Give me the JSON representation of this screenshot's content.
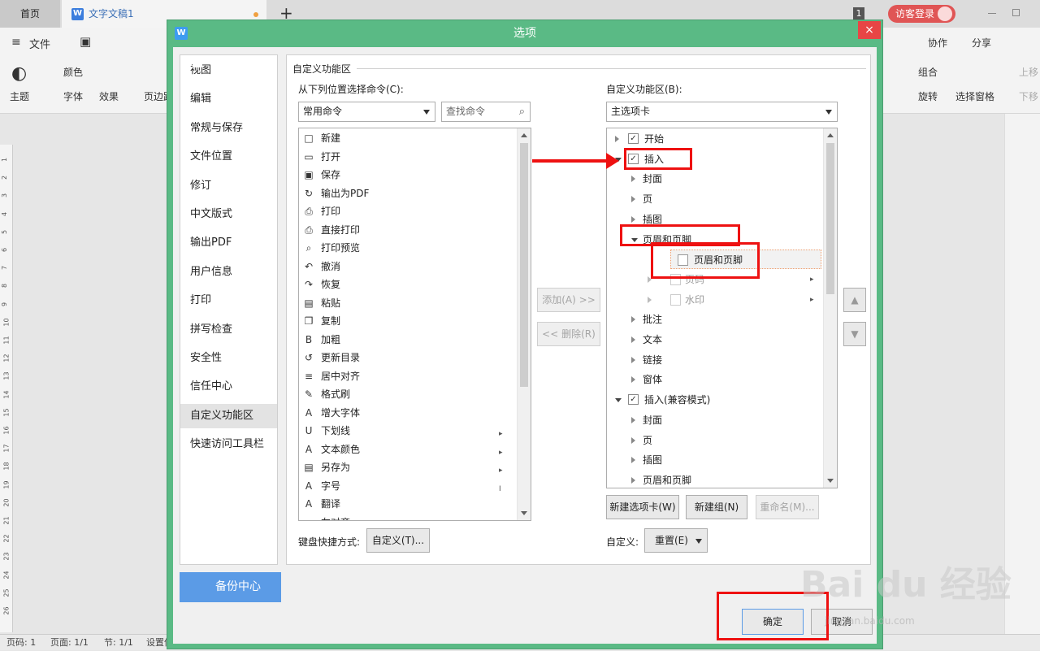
{
  "titlebar": {
    "tab_home": "首页",
    "tab_doc": "文字文稿1",
    "tab_doc_icon": "W",
    "new_tab": "+",
    "badge": "1",
    "login": "访客登录"
  },
  "ribbon": {
    "file": "文件",
    "collab": "协作",
    "share": "分享",
    "item_theme": "主题",
    "item_color": "颜色",
    "item_font": "字体",
    "item_effect": "效果",
    "item_margin": "页边距",
    "item_group": "组合",
    "item_rotate": "旋转",
    "item_select_pane": "选择窗格",
    "item_move_up": "上移",
    "item_move_down": "下移"
  },
  "ruler": [
    "1",
    "2",
    "3",
    "4",
    "5",
    "6",
    "7",
    "8",
    "9",
    "10",
    "11",
    "12",
    "13",
    "14",
    "15",
    "16",
    "17",
    "18",
    "19",
    "20",
    "21",
    "22",
    "23",
    "24",
    "25",
    "26"
  ],
  "statusbar": {
    "page": "页码: 1",
    "pages": "页面: 1/1",
    "section": "节: 1/1",
    "settings": "设置值"
  },
  "dialog": {
    "title": "选项",
    "icon": "W",
    "close": "×",
    "nav": [
      "视图",
      "编辑",
      "常规与保存",
      "文件位置",
      "修订",
      "中文版式",
      "输出PDF",
      "用户信息",
      "打印",
      "拼写检查",
      "安全性",
      "信任中心",
      "自定义功能区",
      "快速访问工具栏"
    ],
    "nav_active": "自定义功能区",
    "backup": "备份中心",
    "section_title": "自定义功能区",
    "left_label": "从下列位置选择命令(C):",
    "left_combo": "常用命令",
    "search_placeholder": "查找命令",
    "right_label": "自定义功能区(B):",
    "right_combo": "主选项卡",
    "commands": [
      {
        "label": "新建",
        "icon": "□"
      },
      {
        "label": "打开",
        "icon": "▭"
      },
      {
        "label": "保存",
        "icon": "▣"
      },
      {
        "label": "输出为PDF",
        "icon": "↻"
      },
      {
        "label": "打印",
        "icon": "⎙"
      },
      {
        "label": "直接打印",
        "icon": "⎙"
      },
      {
        "label": "打印预览",
        "icon": "⌕"
      },
      {
        "label": "撤消",
        "icon": "↶"
      },
      {
        "label": "恢复",
        "icon": "↷"
      },
      {
        "label": "粘贴",
        "icon": "▤"
      },
      {
        "label": "复制",
        "icon": "❐"
      },
      {
        "label": "加粗",
        "icon": "B"
      },
      {
        "label": "更新目录",
        "icon": "↺"
      },
      {
        "label": "居中对齐",
        "icon": "≡"
      },
      {
        "label": "格式刷",
        "icon": "✎"
      },
      {
        "label": "增大字体",
        "icon": "A"
      },
      {
        "label": "下划线",
        "icon": "U",
        "sub": "▸"
      },
      {
        "label": "文本颜色",
        "icon": "A",
        "sub": "▸"
      },
      {
        "label": "另存为",
        "icon": "▤",
        "sub": "▸"
      },
      {
        "label": "字号",
        "icon": "A",
        "sub": "I"
      },
      {
        "label": "翻译",
        "icon": "A"
      },
      {
        "label": "左对齐",
        "icon": "≡"
      }
    ],
    "add_btn": "添加(A) >>",
    "remove_btn": "<< 删除(R)",
    "tree": [
      {
        "label": "开始",
        "indent": 0,
        "exp": "r",
        "chk": true
      },
      {
        "label": "插入",
        "indent": 0,
        "exp": "d",
        "chk": true
      },
      {
        "label": "封面",
        "indent": 1,
        "exp": "r"
      },
      {
        "label": "页",
        "indent": 1,
        "exp": "r"
      },
      {
        "label": "插图",
        "indent": 1,
        "exp": "r"
      },
      {
        "label": "页眉和页脚",
        "indent": 1,
        "exp": "d"
      },
      {
        "label": "页眉和页脚",
        "indent": 2,
        "icon": true,
        "sel": true
      },
      {
        "label": "页码",
        "indent": 2,
        "exp": "r",
        "icon": true,
        "gray": true,
        "more": true
      },
      {
        "label": "水印",
        "indent": 2,
        "exp": "r",
        "icon": true,
        "gray": true,
        "more": true
      },
      {
        "label": "批注",
        "indent": 1,
        "exp": "r"
      },
      {
        "label": "文本",
        "indent": 1,
        "exp": "r"
      },
      {
        "label": "链接",
        "indent": 1,
        "exp": "r"
      },
      {
        "label": "窗体",
        "indent": 1,
        "exp": "r"
      },
      {
        "label": "插入(兼容模式)",
        "indent": 0,
        "exp": "d",
        "chk": true
      },
      {
        "label": "封面",
        "indent": 1,
        "exp": "r"
      },
      {
        "label": "页",
        "indent": 1,
        "exp": "r"
      },
      {
        "label": "插图",
        "indent": 1,
        "exp": "r"
      },
      {
        "label": "页眉和页脚",
        "indent": 1,
        "exp": "r"
      }
    ],
    "new_tab_btn": "新建选项卡(W)",
    "new_group_btn": "新建组(N)",
    "rename_btn": "重命名(M)...",
    "keyboard_label": "键盘快捷方式:",
    "keyboard_btn": "自定义(T)...",
    "custom_label": "自定义:",
    "reset_btn": "重置(E)",
    "ok": "确定",
    "cancel": "取消"
  },
  "watermark": {
    "logo": "Bai du 经验",
    "url": "jingyan.baidu.com"
  }
}
